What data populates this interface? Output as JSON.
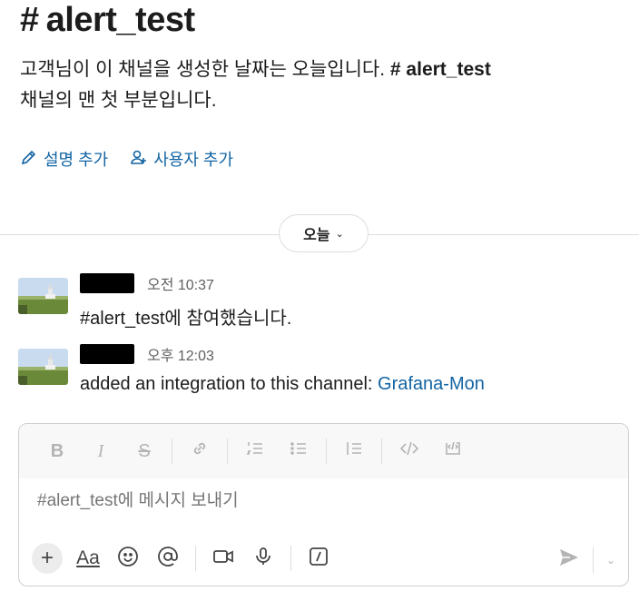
{
  "channel": {
    "hash": "#",
    "name": "alert_test"
  },
  "intro": {
    "text_before": "고객님이 이 채널을 생성한 날짜는 오늘입니다. ",
    "bold_channel": "# alert_test",
    "text_after": " 채널의 맨 첫 부분입니다."
  },
  "actions": {
    "add_description": "설명 추가",
    "add_people": "사용자 추가"
  },
  "date_divider": {
    "label": "오늘",
    "chevron": "⌄"
  },
  "messages": [
    {
      "time": "오전 10:37",
      "text": "#alert_test에 참여했습니다."
    },
    {
      "time": "오후 12:03",
      "text_before": "added an integration to this channel: ",
      "link": "Grafana-Mon"
    }
  ],
  "composer": {
    "placeholder": "#alert_test에 메시지 보내기",
    "format_buttons": [
      "bold",
      "italic",
      "strikethrough",
      "link",
      "ordered-list",
      "bulleted-list",
      "blockquote",
      "code",
      "code-block"
    ],
    "bottom_buttons": [
      "plus",
      "format-text",
      "emoji",
      "mention",
      "video",
      "microphone",
      "slash-command",
      "send",
      "send-options"
    ]
  },
  "colors": {
    "link": "#1264a3",
    "text": "#1d1c1d",
    "muted": "#616061"
  }
}
